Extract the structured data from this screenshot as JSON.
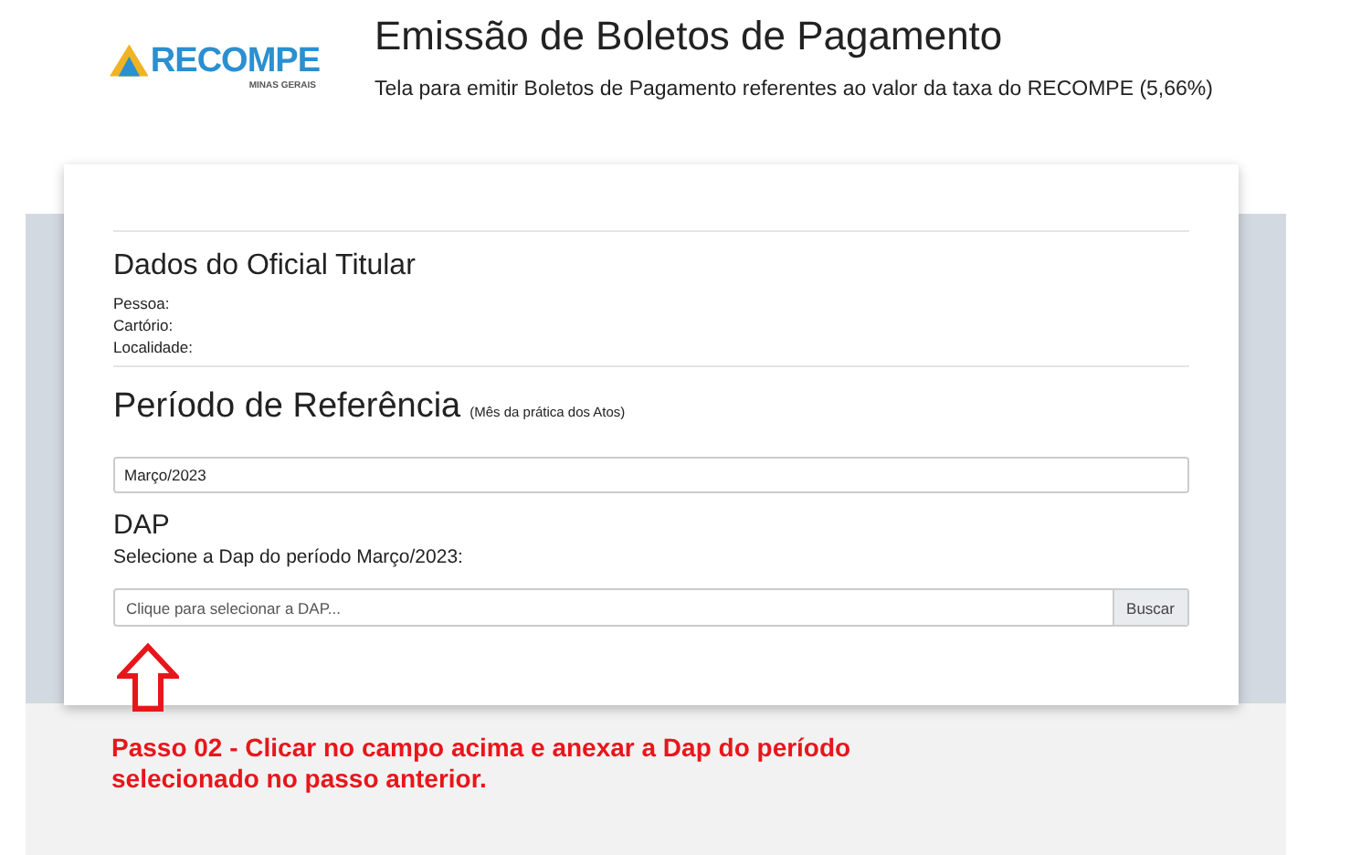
{
  "logo": {
    "text": "RECOMPE",
    "subtext": "MINAS GERAIS"
  },
  "header": {
    "title": "Emissão de Boletos de Pagamento",
    "subtitle": "Tela para emitir Boletos de Pagamento referentes ao valor da taxa do RECOMPE (5,66%)"
  },
  "titular": {
    "heading": "Dados do Oficial Titular",
    "fields": [
      "Pessoa:",
      "Cartório:",
      "Localidade:"
    ]
  },
  "periodo": {
    "heading": "Período de Referência",
    "note": "(Mês da prática dos Atos)",
    "value": "Março/2023"
  },
  "dap": {
    "heading": "DAP",
    "label": "Selecione a Dap do período Março/2023:",
    "placeholder": "Clique para selecionar a DAP...",
    "button": "Buscar"
  },
  "instruction": "Passo 02 - Clicar no campo acima e anexar a Dap do período selecionado no passo anterior."
}
